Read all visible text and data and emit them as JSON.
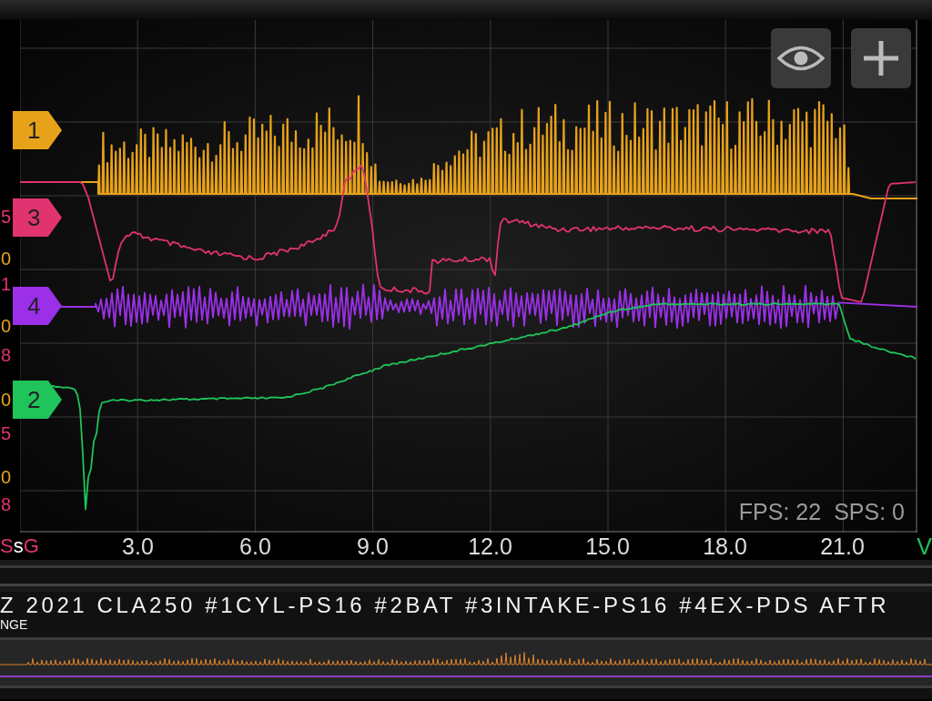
{
  "plot": {
    "buttons": [
      {
        "kind": "eye"
      },
      {
        "kind": "plus"
      }
    ],
    "channels": [
      {
        "label": "1",
        "kind": "spikes",
        "color": "#e8a21a"
      },
      {
        "label": "3",
        "kind": "steps",
        "color": "#e0336f"
      },
      {
        "label": "4",
        "kind": "bursts",
        "color": "#9b30e8"
      },
      {
        "label": "2",
        "kind": "ramp",
        "color": "#1fc45a"
      }
    ],
    "y_axis_labels": [
      {
        "text": "5",
        "color": "#e0336f"
      },
      {
        "text": "0",
        "color": "#e8a21a"
      },
      {
        "text": "1",
        "color": "#e0336f"
      },
      {
        "text": "0",
        "color": "#e8a21a"
      },
      {
        "text": "8",
        "color": "#e0336f"
      },
      {
        "text": "0",
        "color": "#e8a21a"
      },
      {
        "text": "5",
        "color": "#e0336f"
      },
      {
        "text": "0",
        "color": "#e8a21a"
      },
      {
        "text": "8",
        "color": "#e0336f"
      }
    ],
    "stats": [
      "FPS: 22",
      "SPS: 0"
    ]
  },
  "x_axis": {
    "unit_marks": [
      {
        "text": "S",
        "color": "#e0336f"
      },
      {
        "text": "s",
        "color": "#ffffff"
      },
      {
        "text": "G",
        "color": "#e0336f"
      }
    ],
    "ticks": [
      "3.0",
      "6.0",
      "9.0",
      "12.0",
      "15.0",
      "18.0",
      "21.0"
    ],
    "right_mark": {
      "text": "V",
      "color": "#1fc45a"
    }
  },
  "title": "Z 2021 CLA250 #1CYL-PS16 #2BAT #3INTAKE-PS16 #4EX-PDS AFTR",
  "title_second_line": "NGE"
}
